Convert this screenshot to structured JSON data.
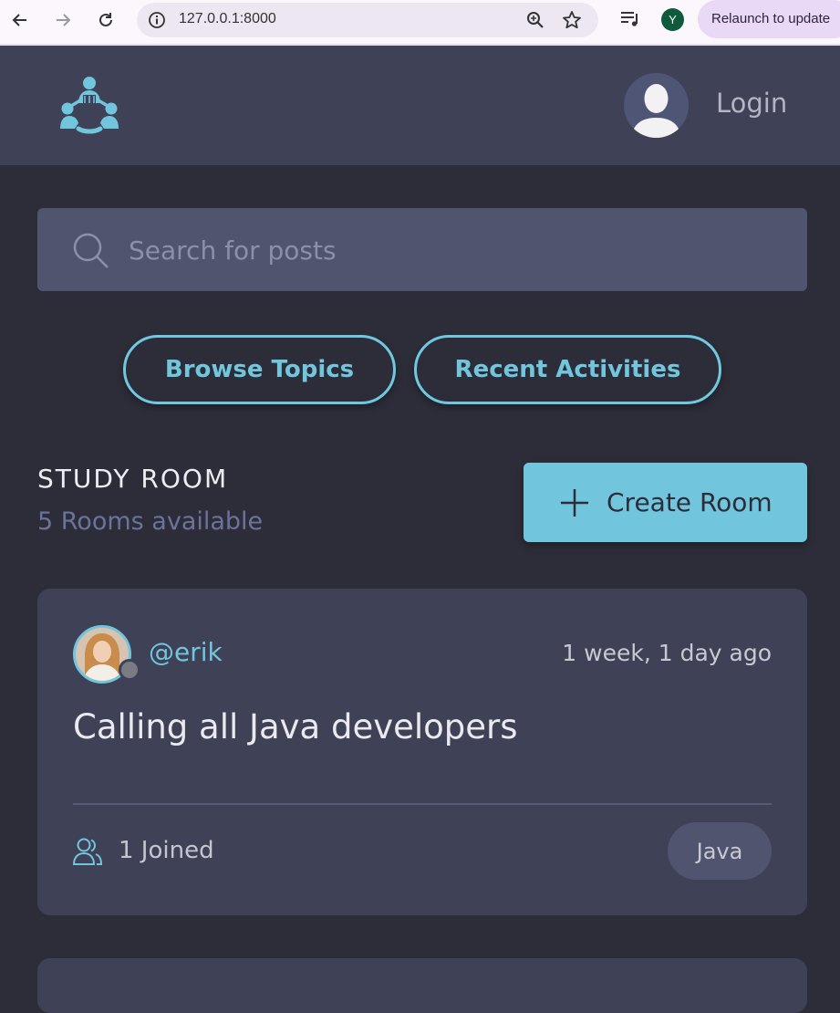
{
  "browser": {
    "url": "127.0.0.1:8000",
    "profile_initial": "Y",
    "relaunch_label": "Relaunch to update"
  },
  "header": {
    "login_label": "Login"
  },
  "search": {
    "placeholder": "Search for posts"
  },
  "nav_buttons": {
    "browse_topics": "Browse Topics",
    "recent_activities": "Recent Activities"
  },
  "study_room": {
    "title": "STUDY ROOM",
    "count_label": "5 Rooms available",
    "create_label": "Create Room"
  },
  "rooms": [
    {
      "host": "@erik",
      "time": "1 week, 1 day ago",
      "title": "Calling all Java developers",
      "joined": "1 Joined",
      "topic": "Java"
    }
  ],
  "colors": {
    "accent": "#71c6dd",
    "background": "#2d2d39",
    "header": "#3f4156",
    "card": "#3f4156",
    "input": "#51546e"
  }
}
